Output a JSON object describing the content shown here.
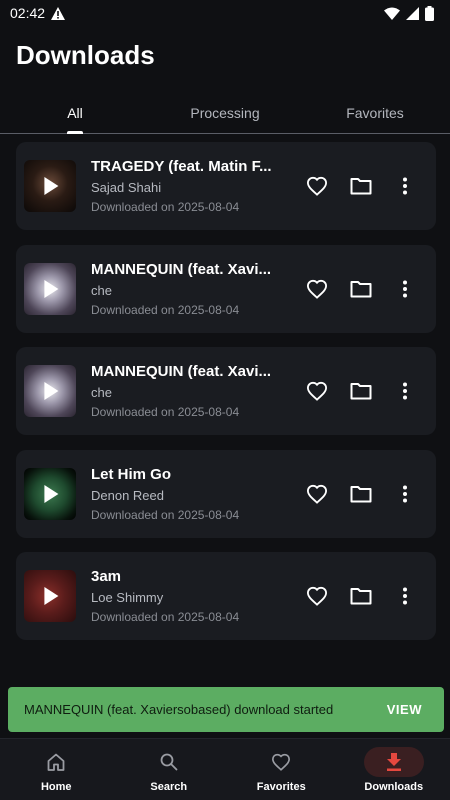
{
  "status": {
    "time": "02:42"
  },
  "header": {
    "title": "Downloads"
  },
  "tabs": [
    {
      "label": "All",
      "active": true
    },
    {
      "label": "Processing",
      "active": false
    },
    {
      "label": "Favorites",
      "active": false
    }
  ],
  "downloads": [
    {
      "title": "TRAGEDY (feat. Matin F...",
      "artist": "Sajad Shahi",
      "date": "Downloaded on 2025-08-04"
    },
    {
      "title": "MANNEQUIN (feat. Xavi...",
      "artist": "che",
      "date": "Downloaded on 2025-08-04"
    },
    {
      "title": "MANNEQUIN (feat. Xavi...",
      "artist": "che",
      "date": "Downloaded on 2025-08-04"
    },
    {
      "title": "Let Him Go",
      "artist": "Denon Reed",
      "date": "Downloaded on 2025-08-04"
    },
    {
      "title": "3am",
      "artist": "Loe Shimmy",
      "date": "Downloaded on 2025-08-04"
    }
  ],
  "snackbar": {
    "message": "MANNEQUIN (feat. Xaviersobased) download started",
    "action": "VIEW"
  },
  "bottom_nav": [
    {
      "label": "Home",
      "icon": "home-icon"
    },
    {
      "label": "Search",
      "icon": "search-icon"
    },
    {
      "label": "Favorites",
      "icon": "heart-icon"
    },
    {
      "label": "Downloads",
      "icon": "download-icon",
      "active": true
    }
  ],
  "colors": {
    "background": "#0f1013",
    "card": "#1a1c21",
    "snackbar": "#5cad62",
    "accent": "#e5483f",
    "nav_active_bg": "#3a1f21"
  }
}
